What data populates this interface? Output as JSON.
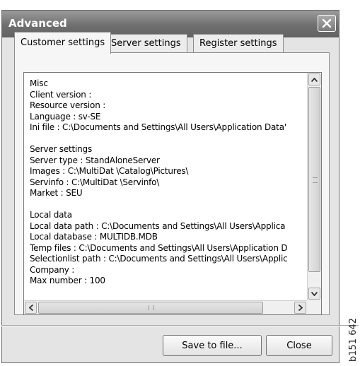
{
  "window": {
    "title": "Advanced"
  },
  "tabs": [
    {
      "label": "Customer settings",
      "active": true
    },
    {
      "label": "Server settings",
      "active": false
    },
    {
      "label": "Register settings",
      "active": false
    }
  ],
  "content_lines": [
    "Misc",
    "Client version :",
    "Resource version :",
    "Language : sv-SE",
    "Ini file : C:\\Documents and Settings\\All Users\\Application Data'",
    "",
    "Server settings",
    "Server type : StandAloneServer",
    "Images : C:\\MultiDat \\Catalog\\Pictures\\",
    "Servinfo : C:\\MultiDat \\Servinfo\\",
    "Market : SEU",
    "",
    "Local data",
    "Local data path : C:\\Documents and Settings\\All Users\\Applica",
    "Local database : MULTIDB.MDB",
    "Temp files : C:\\Documents and Settings\\All Users\\Application D",
    "Selectionlist path : C:\\Documents and Settings\\All Users\\Applic",
    "Company :",
    "Max number : 100"
  ],
  "buttons": {
    "save": "Save to file...",
    "close": "Close"
  },
  "figure_code": "b151 642",
  "icons": [
    "close-icon",
    "scroll-up-icon",
    "scroll-down-icon",
    "scroll-left-icon",
    "scroll-right-icon"
  ]
}
